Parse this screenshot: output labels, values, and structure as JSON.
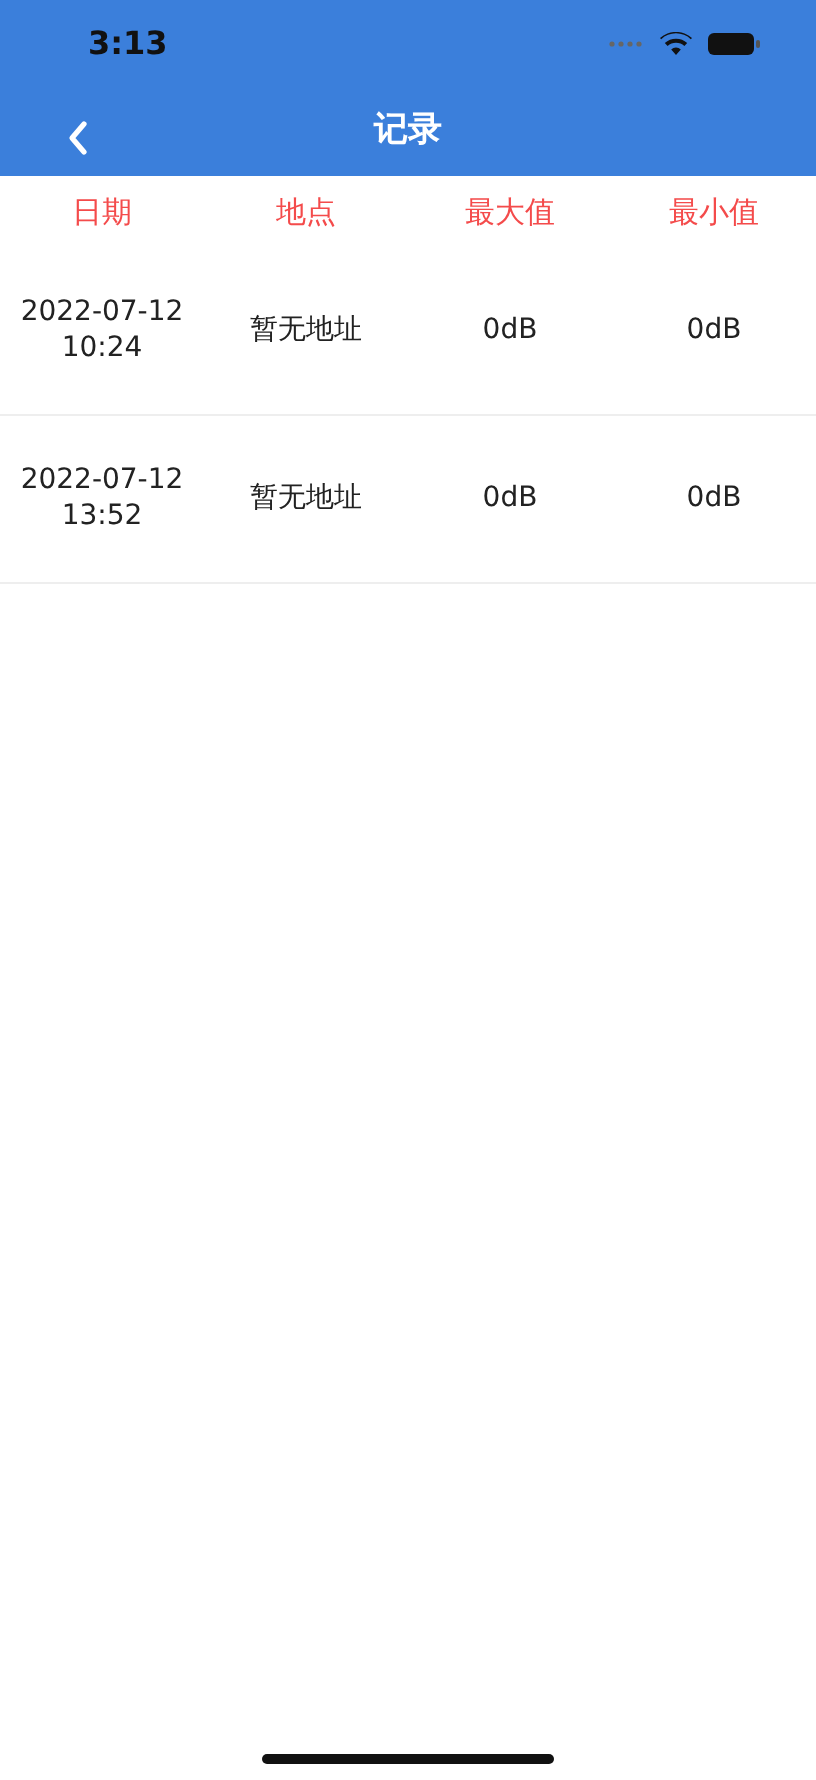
{
  "status_bar": {
    "time": "3:13"
  },
  "nav_bar": {
    "title": "记录"
  },
  "table": {
    "columns": [
      "日期",
      "地点",
      "最大值",
      "最小值"
    ],
    "rows": [
      {
        "date": "2022-07-12",
        "time": "10:24",
        "location": "暂无地址",
        "max": "0dB",
        "min": "0dB"
      },
      {
        "date": "2022-07-12",
        "time": "13:52",
        "location": "暂无地址",
        "max": "0dB",
        "min": "0dB"
      }
    ]
  }
}
